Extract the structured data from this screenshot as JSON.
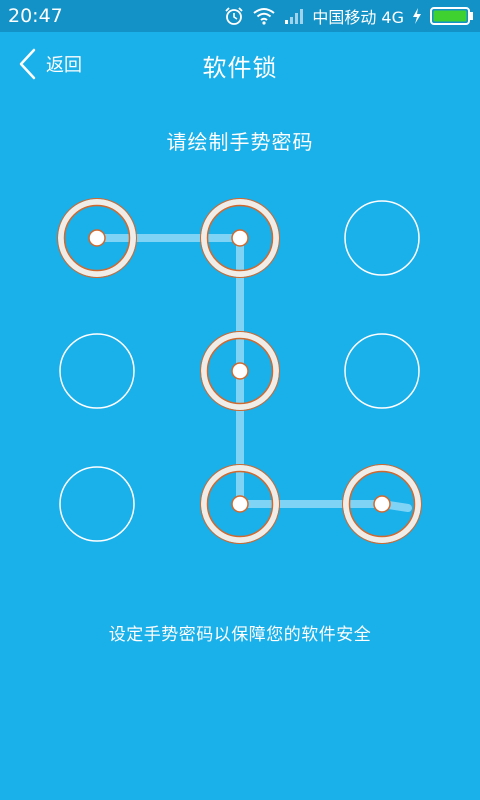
{
  "status_bar": {
    "time": "20:47",
    "carrier": "中国移动 4G",
    "icons": [
      "alarm-icon",
      "wifi-icon",
      "signal-icon",
      "charging-icon",
      "battery-icon"
    ]
  },
  "nav": {
    "back_label": "返回",
    "title": "软件锁"
  },
  "pattern": {
    "prompt": "请绘制手势密码",
    "dots": [
      {
        "id": 1,
        "selected": true
      },
      {
        "id": 2,
        "selected": true
      },
      {
        "id": 3,
        "selected": false
      },
      {
        "id": 4,
        "selected": false
      },
      {
        "id": 5,
        "selected": true
      },
      {
        "id": 6,
        "selected": false
      },
      {
        "id": 7,
        "selected": false
      },
      {
        "id": 8,
        "selected": true
      },
      {
        "id": 9,
        "selected": true
      }
    ],
    "path": [
      1,
      2,
      5,
      8,
      9
    ]
  },
  "hint": "设定手势密码以保障您的软件安全",
  "colors": {
    "background": "#1ab0ea",
    "status_bar": "#1392c7",
    "selected_ring": "#f0ede8",
    "selected_ring_inner": "#d1692e",
    "connector": "#7fd4f5",
    "battery": "#3fd12f"
  }
}
